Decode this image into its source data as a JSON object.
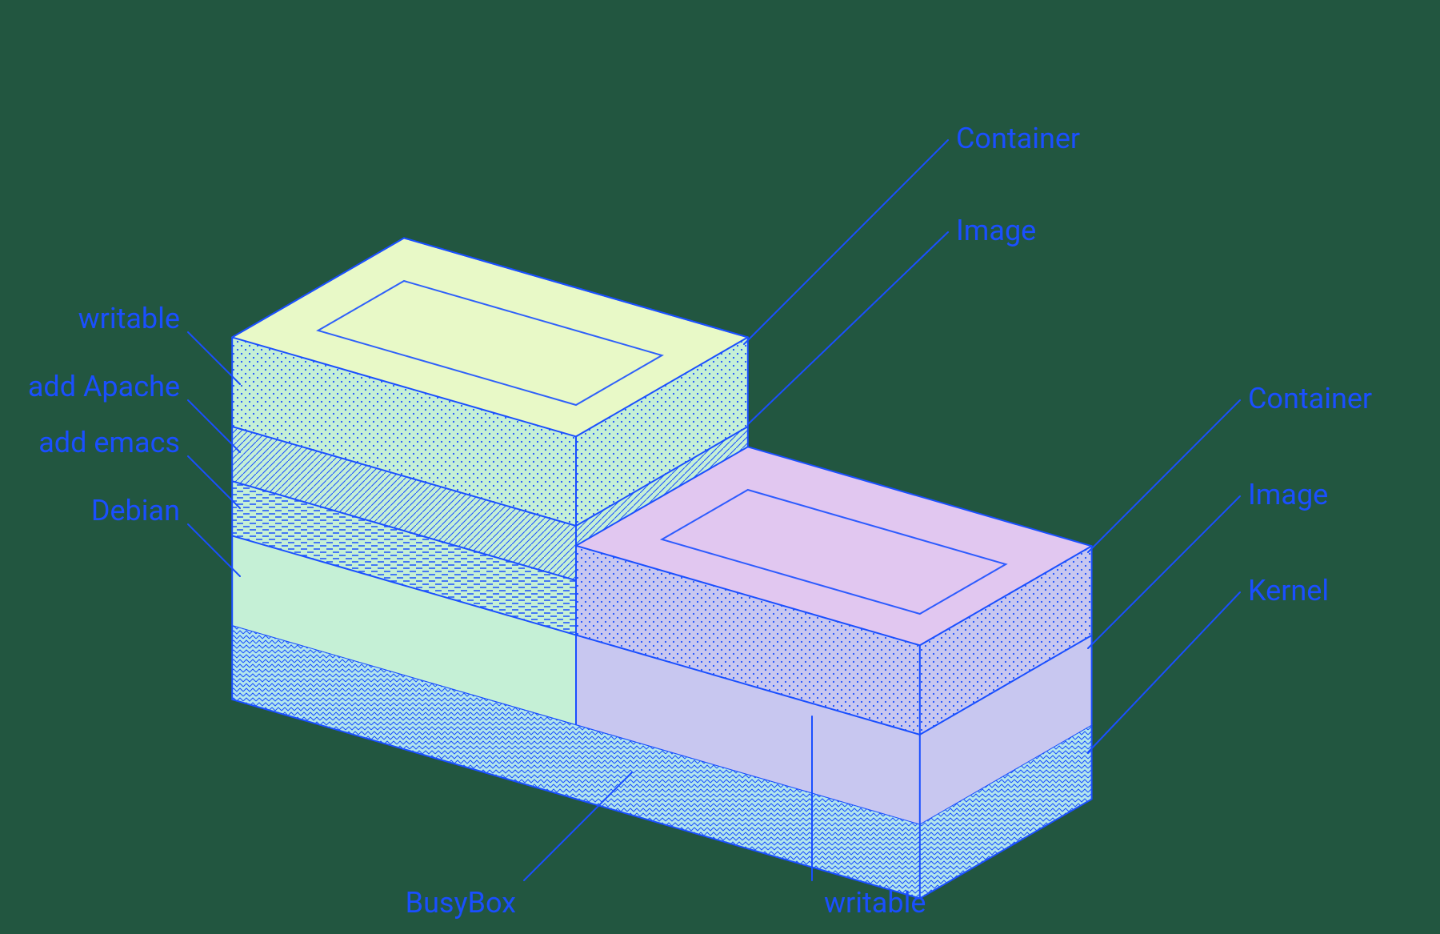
{
  "labels": {
    "left_container": "Container",
    "left_image": "Image",
    "right_container": "Container",
    "right_image": "Image",
    "kernel": "Kernel",
    "writable_left": "writable",
    "add_apache": "add Apache",
    "add_emacs": "add emacs",
    "debian": "Debian",
    "busybox": "BusyBox",
    "writable_right": "writable"
  },
  "colors": {
    "stroke": "#1a4fff",
    "kernel": "#b3e6ec",
    "green_solid": "#c5f0d6",
    "green_top": "#e8f9c7",
    "purple_top": "#e1c7f0",
    "purple_side": "#c8c7f0"
  }
}
